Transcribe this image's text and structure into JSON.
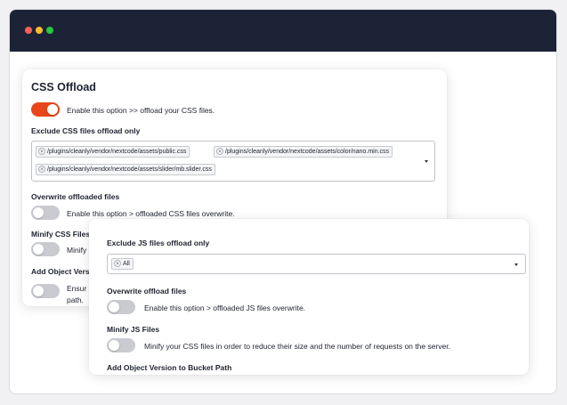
{
  "css_offload": {
    "title": "CSS Offload",
    "enable_label": "Enable this option >> offload your CSS files.",
    "exclude_label": "Exclude CSS files offload only",
    "exclude_tags": [
      "/plugins/cleanly/vendor/nextcode/assets/public.css",
      "/plugins/cleanly/vendor/nextcode/assets/color/nano.min.css",
      "/plugins/cleanly/vendor/nextcode/assets/slider/mb.slider.css"
    ],
    "overwrite_label": "Overwrite offloaded files",
    "overwrite_text": "Enable this option > offloaded CSS files overwrite.",
    "minify_label": "Minify CSS Files",
    "minify_text": "Minify",
    "object_version_label": "Add Object Versio",
    "object_version_text_1": "Ensur",
    "object_version_text_2": "path."
  },
  "js_offload": {
    "exclude_label": "Exclude JS files offload only",
    "exclude_tag": "All",
    "overwrite_label": "Overwrite offload files",
    "overwrite_text": "Enable this option > offloaded JS files overwrite.",
    "minify_label": "Minify JS Files",
    "minify_text": "Minify your CSS files in order to reduce their size and the number of requests on the server.",
    "object_version_label": "Add Object Version to Bucket Path"
  },
  "colors": {
    "titlebar": "#1d2336",
    "toggle_on": "#e8461a",
    "toggle_off": "#c9cbd0"
  },
  "toggles": {
    "css_enable": true,
    "css_overwrite": false,
    "css_minify": false,
    "css_object_version": false,
    "js_overwrite": false,
    "js_minify": false
  }
}
